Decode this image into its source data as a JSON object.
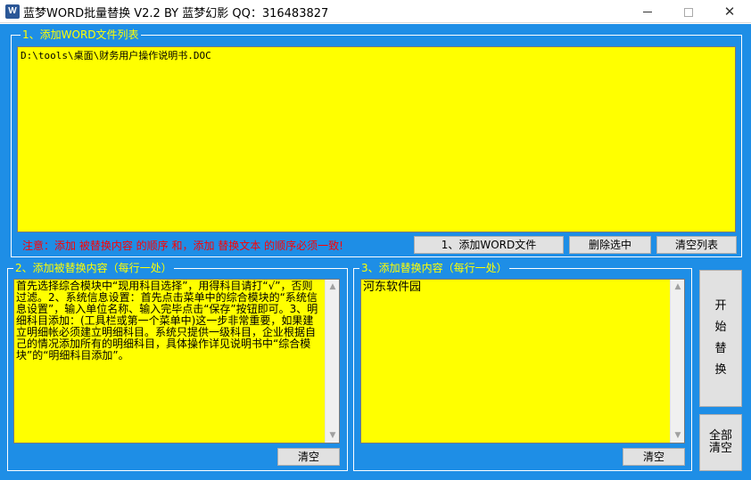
{
  "window": {
    "title": "蓝梦WORD批量替换 V2.2 BY 蓝梦幻影 QQ：316483827",
    "icon": "word-app-icon",
    "min_label": "minimize",
    "max_label": "maximize",
    "close_glyph": "✕"
  },
  "colors": {
    "client_bg": "#1e8ee6",
    "field_bg": "#ffff00",
    "legend_text": "#ffff00",
    "note_text": "#ff0000"
  },
  "group1": {
    "legend": "1、添加WORD文件列表",
    "files": [
      "D:\\tools\\桌面\\财务用户操作说明书.DOC"
    ],
    "note": "注意：添加 被替换内容 的顺序 和，添加 替换文本 的顺序必须一致!",
    "add_button": "1、添加WORD文件",
    "delete_button": "删除选中",
    "clear_button": "清空列表"
  },
  "group2": {
    "legend": "2、添加被替换内容（每行一处）",
    "text": "首先选择综合模块中“现用科目选择”，用得科目请打“√”，否则过滤。2、系统信息设置：首先点击菜单中的综合模块的“系统信息设置”，输入单位名称、输入完毕点击“保存”按钮即可。3、明细科目添加：(工具栏或第一个菜单中)这一步非常重要，如果建立明细帐必须建立明细科目。系统只提供一级科目，企业根据自己的情况添加所有的明细科目，具体操作详见说明书中“综合模块”的“明细科目添加”。",
    "clear_button": "清空"
  },
  "group3": {
    "legend": "3、添加替换内容（每行一处）",
    "text": "河东软件园",
    "clear_button": "清空"
  },
  "start_button": [
    "开",
    "始",
    "替",
    "换"
  ],
  "clear_all_button": [
    "全部",
    "清空"
  ]
}
